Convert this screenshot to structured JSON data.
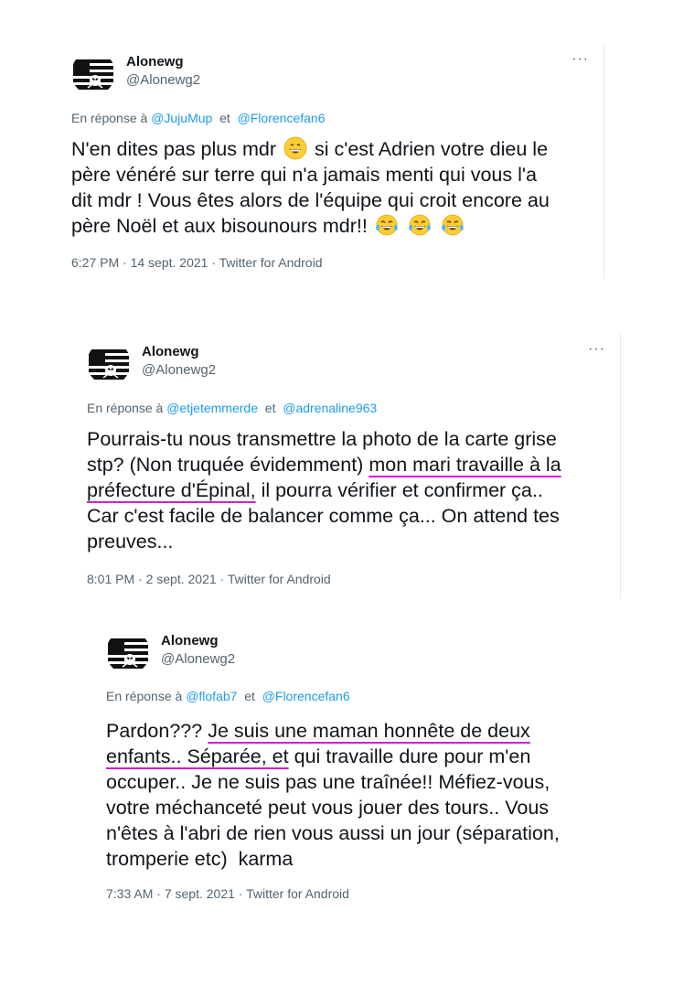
{
  "tweets": [
    {
      "name": "Alonewg",
      "handle": "@Alonewg2",
      "reply_prefix": "En réponse à",
      "mentions": [
        "@JujuMup",
        "@Florencefan6"
      ],
      "reply_sep": "et",
      "body": {
        "line1a": "N'en dites pas plus mdr",
        "line1b": "si c'est Adrien votre dieu le",
        "line2": "père vénéré sur terre qui n'a jamais menti qui vous l'a",
        "line3": "dit mdr ! Vous êtes alors de l'équipe qui croit encore au",
        "line4": "père Noël et aux bisounours mdr!!"
      },
      "time": "6:27 PM",
      "date": "14 sept. 2021",
      "source": "Twitter for Android"
    },
    {
      "name": "Alonewg",
      "handle": "@Alonewg2",
      "reply_prefix": "En réponse à",
      "mentions": [
        "@etjetemmerde",
        "@adrenaline963"
      ],
      "reply_sep": "et",
      "body": {
        "line1": "Pourrais-tu nous transmettre la photo de la carte grise",
        "line2a": "stp? (Non truquée évidemment)",
        "line2b": "mon mari travaille à la",
        "line3a": "préfecture d'Épinal,",
        "line3b": "il pourra vérifier et confirmer ça..",
        "line4": "Car c'est facile de balancer comme ça... On attend tes",
        "line5": "preuves..."
      },
      "time": "8:01 PM",
      "date": "2 sept. 2021",
      "source": "Twitter for Android"
    },
    {
      "name": "Alonewg",
      "handle": "@Alonewg2",
      "reply_prefix": "En réponse à",
      "mentions": [
        "@flofab7",
        "@Florencefan6"
      ],
      "reply_sep": "et",
      "body": {
        "line1a": "Pardon???",
        "line1b": "Je suis une maman honnête de deux",
        "line2a": "enfants.. Séparée, et",
        "line2b": "qui travaille dure pour m'en",
        "line3": "occuper.. Je ne suis pas une traînée!! Méfiez-vous,",
        "line4": "votre méchanceté peut vous jouer des tours.. Vous",
        "line5": "n'êtes à l'abri de rien vous aussi un jour (séparation,",
        "line6": "tromperie etc)  karma"
      },
      "time": "7:33 AM",
      "date": "7 sept. 2021",
      "source": "Twitter for Android"
    }
  ],
  "meta_sep": "·",
  "more_label": "···",
  "icons": {
    "avatar": "flag-skull-avatar",
    "emoji_grin": "grinning-face-emoji",
    "emoji_tears": "tears-of-joy-emoji",
    "more": "more-icon"
  },
  "colors": {
    "link": "#1d9bf0",
    "muted": "#536471",
    "underline": "#d21fcf"
  }
}
